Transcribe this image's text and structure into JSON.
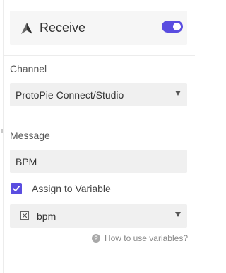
{
  "header": {
    "title": "Receive",
    "icon": "protopie-logo-icon",
    "toggle_on": true,
    "accent_color": "#5a4de0"
  },
  "channel": {
    "label": "Channel",
    "selected_value": "ProtoPie Connect/Studio"
  },
  "message": {
    "label": "Message",
    "value": "BPM"
  },
  "assign": {
    "label": "Assign to Variable",
    "checked": true
  },
  "variable": {
    "selected_value": "bpm",
    "icon": "variable-icon"
  },
  "help": {
    "text": "How to use variables?",
    "icon_glyph": "?"
  }
}
